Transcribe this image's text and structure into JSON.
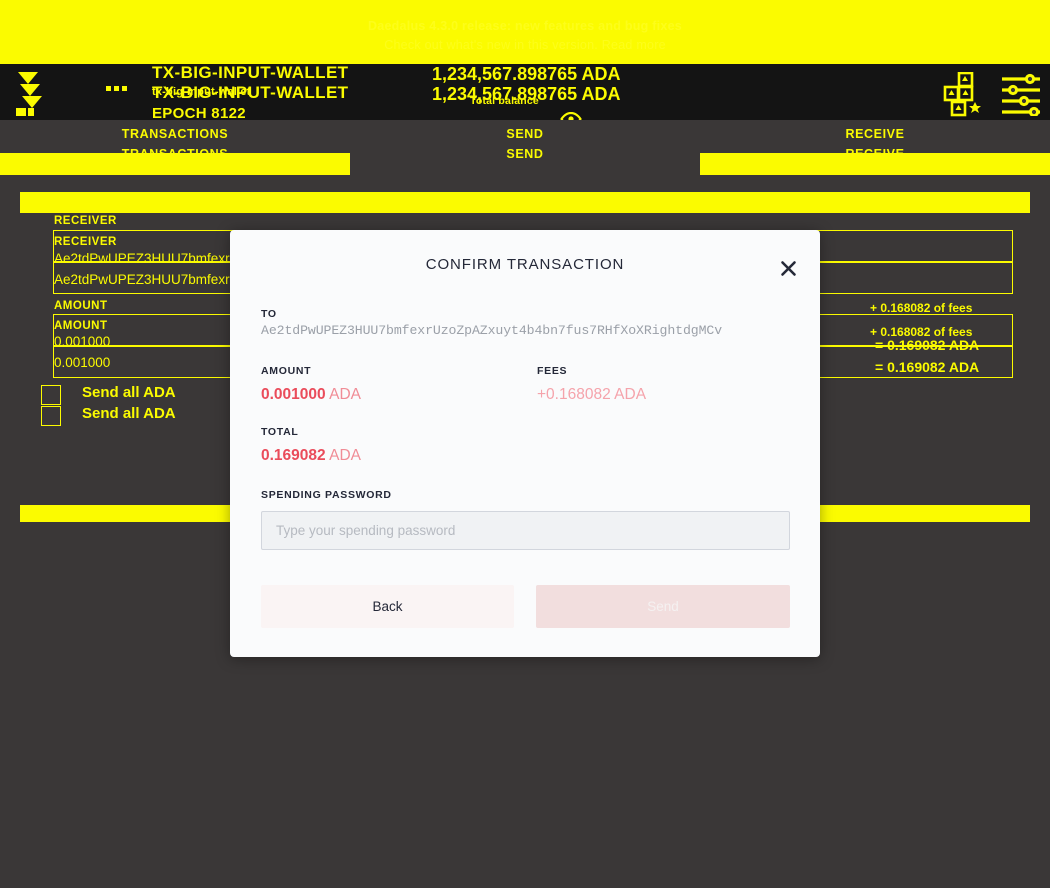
{
  "news_banner": {
    "line1": "Daedalus 4.3.0 release: new features and bug fixes",
    "line2": "Check out what's new in this version. Read more",
    "link_label": "Read more"
  },
  "topbar": {
    "logo_icon": "daedalus-logo-icon",
    "menu_icon": "menu-dots-icon",
    "wallet_name": "TX-BIG-INPUT-WALLET",
    "wallet_sub": "tx-big-input-wallet",
    "wallet_epoch": "EPOCH 8122",
    "balance": "1,234,567.898765 ADA",
    "balance_label": "Total balance",
    "eye_icon": "eye-icon",
    "icons": [
      {
        "name": "delegation-icon"
      },
      {
        "name": "wallet-card-icon"
      },
      {
        "name": "settings-sliders-icon"
      }
    ]
  },
  "tabs": [
    {
      "label": "TRANSACTIONS",
      "active": false
    },
    {
      "label": "SEND",
      "active": true
    },
    {
      "label": "RECEIVE",
      "active": false
    }
  ],
  "send_form": {
    "receiver_label": "RECEIVER",
    "receiver_value": "Ae2tdPwUPEZ3HUU7bmfexrUzoZpAZxuyt4b4bn7fus7RHfXoXRightdgMCv",
    "amount_label": "AMOUNT",
    "amount_value": "0.001000",
    "send_all_label": "Send all ADA",
    "fees_note": "+ 0.168082 of fees",
    "total_note": "= 0.169082 ADA",
    "submit_label": ""
  },
  "modal": {
    "title": "CONFIRM TRANSACTION",
    "close_icon": "close-icon",
    "to_label": "TO",
    "to_address": "Ae2tdPwUPEZ3HUU7bmfexrUzoZpAZxuyt4b4bn7fus7RHfXoXRightdgMCv",
    "amount_label": "AMOUNT",
    "amount_value": "0.001000",
    "amount_unit": "ADA",
    "fees_label": "FEES",
    "fees_value": "+0.168082",
    "fees_unit": "ADA",
    "total_label": "TOTAL",
    "total_value": "0.169082",
    "total_unit": "ADA",
    "password_label": "SPENDING PASSWORD",
    "password_placeholder": "Type your spending password",
    "password_value": "",
    "back_label": "Back",
    "send_label": "Send"
  },
  "colors": {
    "accent_yellow": "#fbfb00",
    "bg_dark": "#3a3737",
    "topbar_dark": "#141414",
    "modal_bg": "#fafbfc",
    "amount_red": "#ea4c5b",
    "fees_pink": "#f5a3ab",
    "title_dark": "#242838"
  }
}
